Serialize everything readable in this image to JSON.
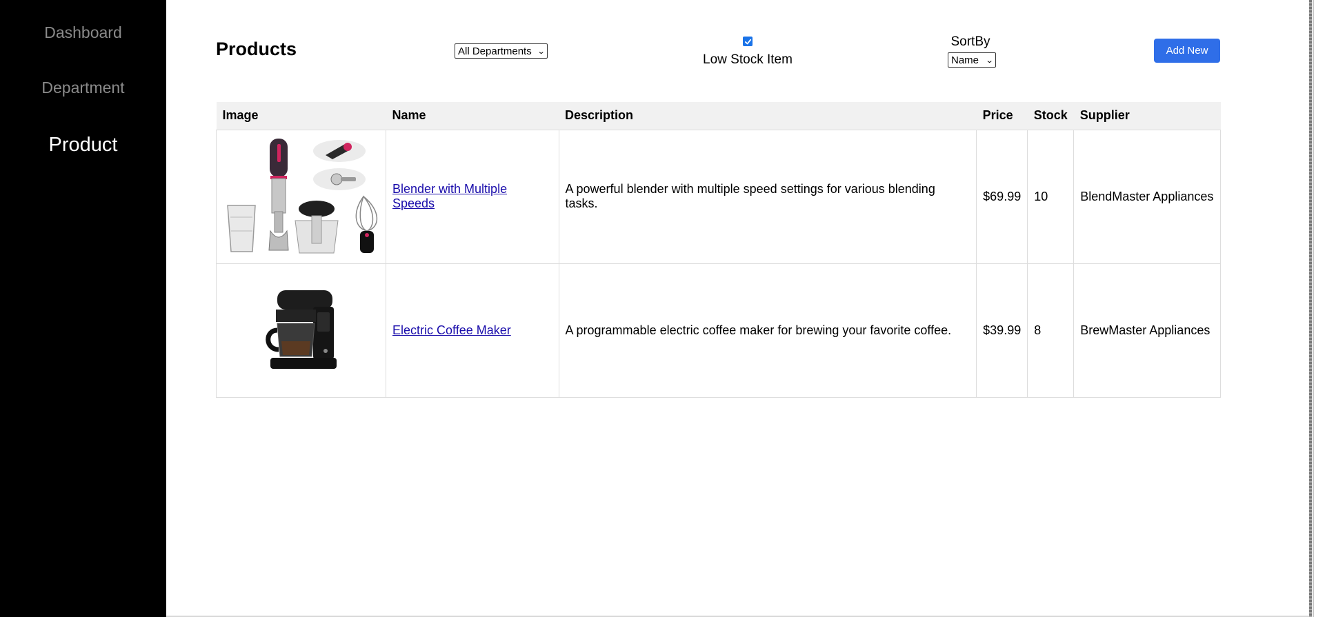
{
  "sidebar": {
    "items": [
      {
        "label": "Dashboard"
      },
      {
        "label": "Department"
      },
      {
        "label": "Product"
      }
    ]
  },
  "header": {
    "title": "Products",
    "department_filter": "All Departments",
    "low_stock_label": "Low Stock Item",
    "low_stock_checked": true,
    "sort_label": "SortBy",
    "sort_value": "Name",
    "add_button": "Add New"
  },
  "table": {
    "columns": [
      "Image",
      "Name",
      "Description",
      "Price",
      "Stock",
      "Supplier"
    ],
    "rows": [
      {
        "image": "blender-image",
        "name": "Blender with Multiple Speeds",
        "description": "A powerful blender with multiple speed settings for various blending tasks.",
        "price": "$69.99",
        "stock": "10",
        "supplier": "BlendMaster Appliances"
      },
      {
        "image": "coffee-maker-image",
        "name": "Electric Coffee Maker",
        "description": "A programmable electric coffee maker for brewing your favorite coffee.",
        "price": "$39.99",
        "stock": "8",
        "supplier": "BrewMaster Appliances"
      }
    ]
  },
  "colors": {
    "accent": "#2f6ee8",
    "sidebar_bg": "#000000",
    "link": "#1a0dab"
  }
}
